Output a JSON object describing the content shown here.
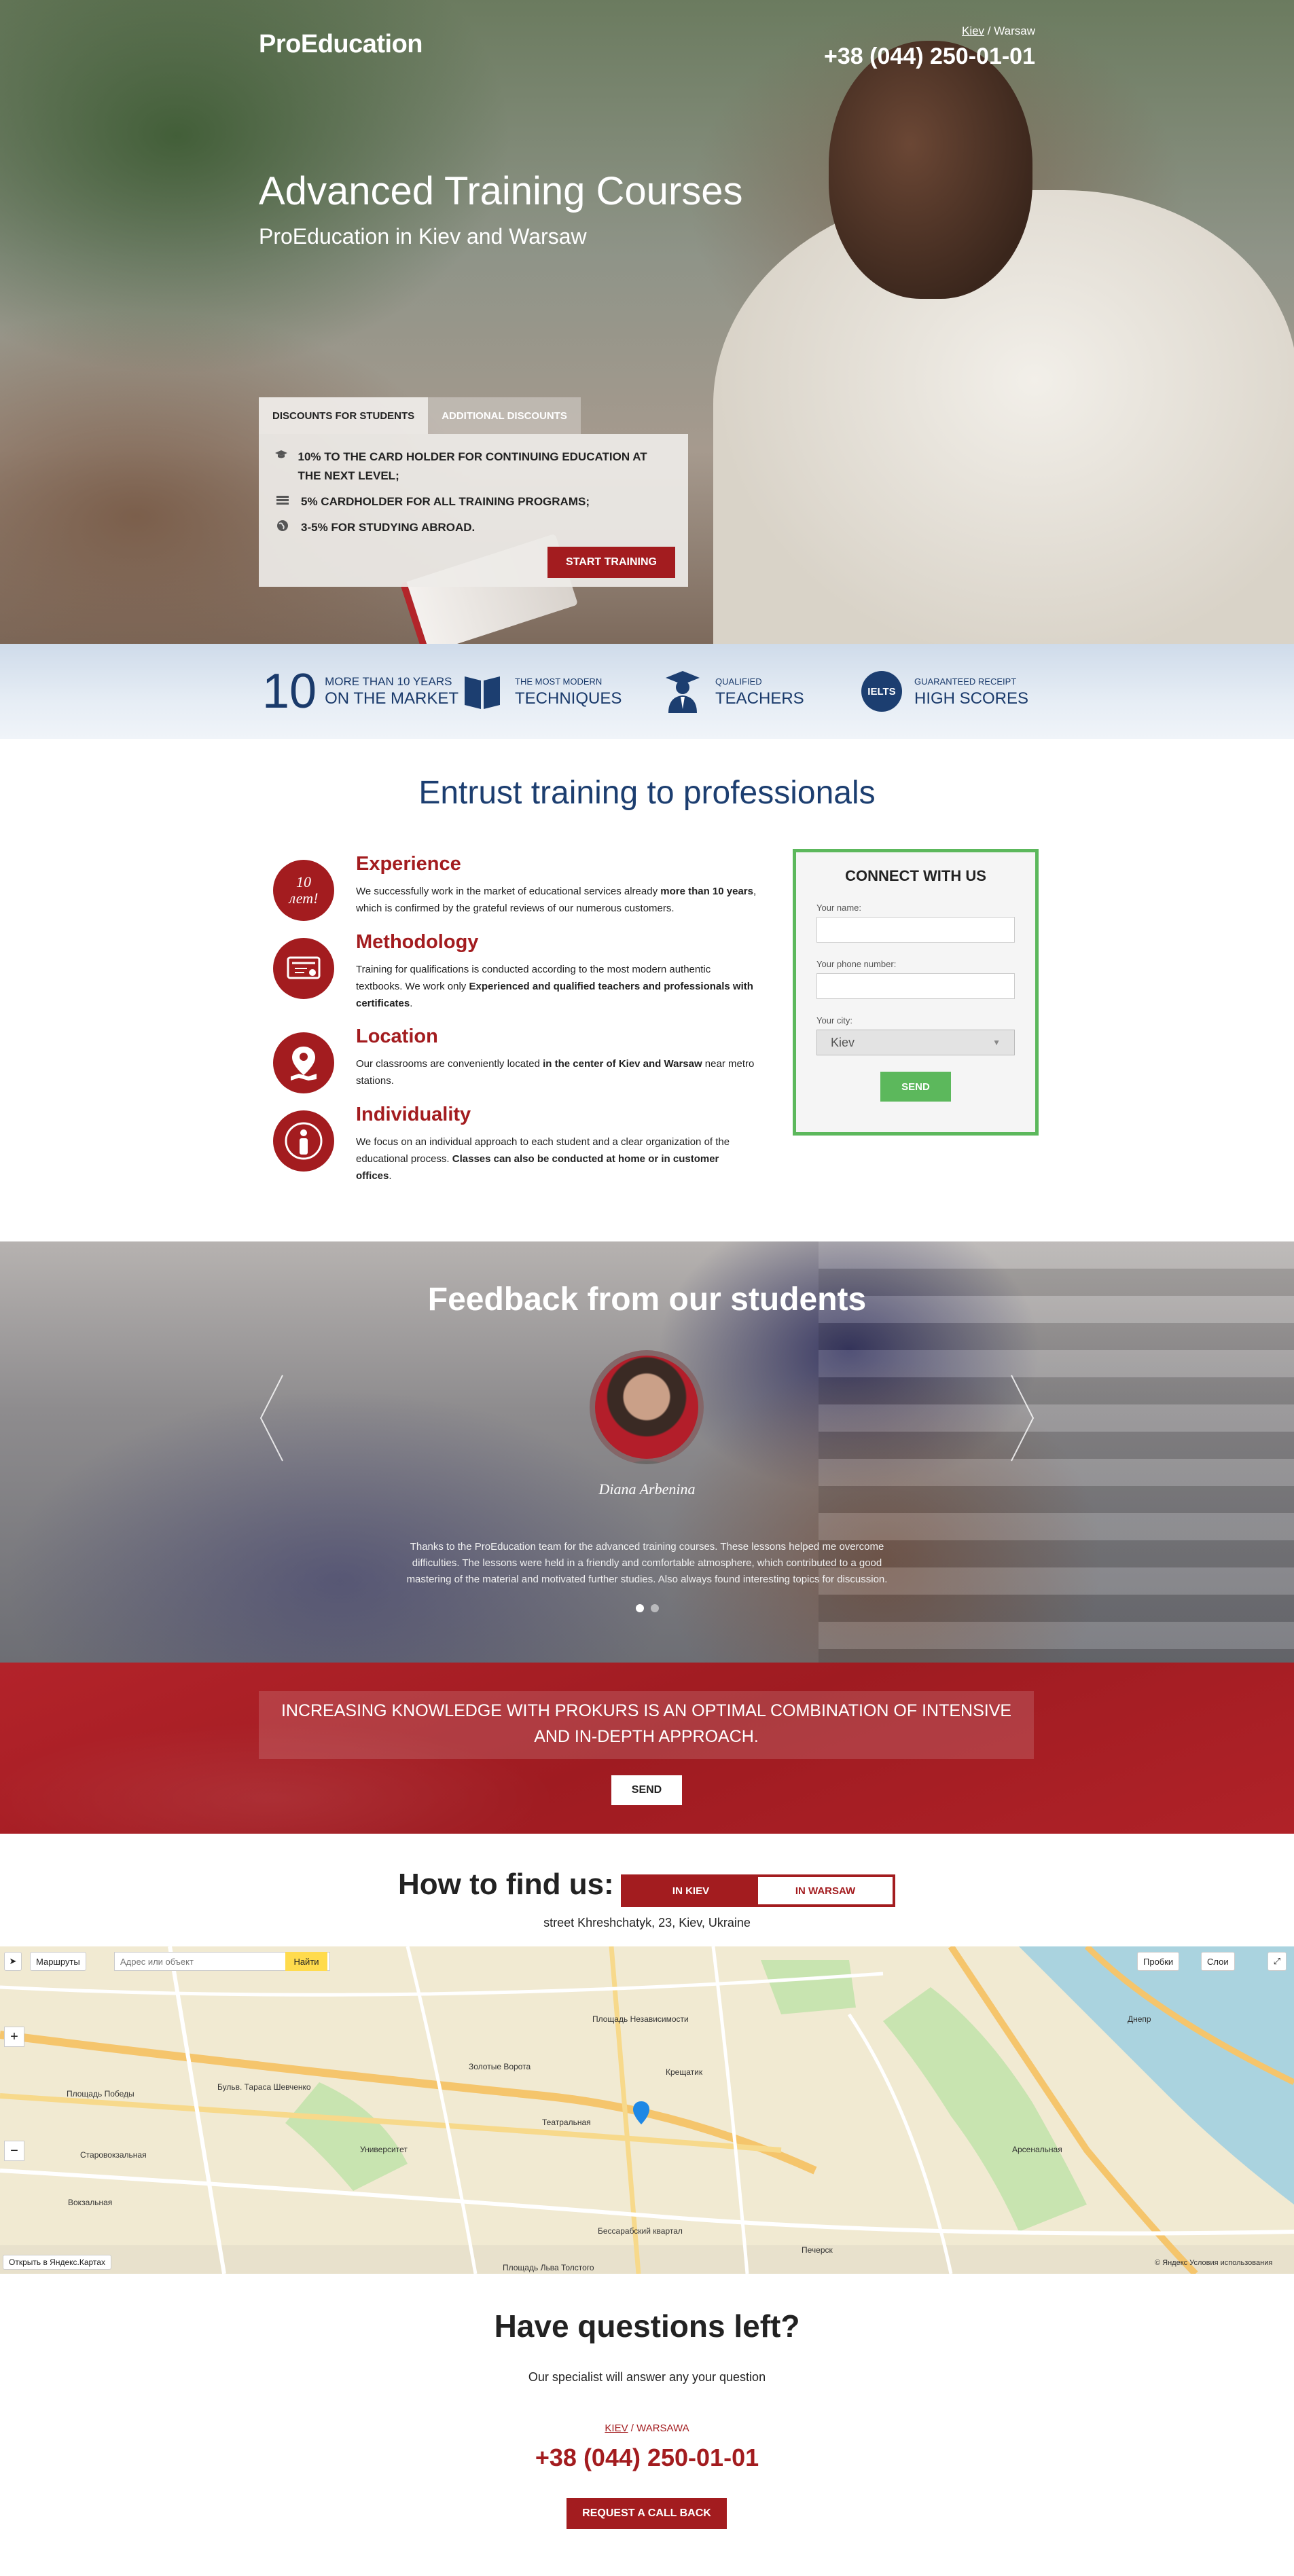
{
  "header": {
    "logo": "ProEducation",
    "city_active": "Kiev",
    "city_separator": " / ",
    "city_other": "Warsaw",
    "phone": "+38 (044) 250-01-01"
  },
  "hero": {
    "title": "Advanced Training Courses",
    "subtitle": "ProEducation in Kiev and Warsaw",
    "tabs": [
      {
        "label": "DISCOUNTS FOR STUDENTS",
        "active": true
      },
      {
        "label": "ADDITIONAL DISCOUNTS",
        "active": false
      }
    ],
    "discounts": [
      {
        "icon": "graduation-cap-icon",
        "text": "10% to the card holder for continuing education at the next level;"
      },
      {
        "icon": "card-icon",
        "text": "5% cardholder for all training programs;"
      },
      {
        "icon": "globe-icon",
        "text": "3-5% for studying abroad."
      }
    ],
    "start_button": "START TRAINING"
  },
  "features": [
    {
      "big": "10",
      "line1": "MORE THAN 10 YEARS",
      "line2": "ON THE MARKET"
    },
    {
      "icon": "book-icon",
      "line1": "THE MOST MODERN",
      "line2": "TECHNIQUES"
    },
    {
      "icon": "teacher-icon",
      "line1": "QUALIFIED",
      "line2": "TEACHERS"
    },
    {
      "icon": "ielts-icon",
      "badge": "IELTS",
      "line1": "GUARANTEED RECEIPT",
      "line2": "HIGH SCORES"
    }
  ],
  "professionals": {
    "title": "Entrust training to professionals",
    "badge_text": "10 лет!",
    "items": [
      {
        "heading": "Experience",
        "text_before": "We successfully work in the market of educational services already ",
        "bold": "more than 10 years",
        "text_after": ", which is confirmed by the grateful reviews of our numerous customers."
      },
      {
        "heading": "Methodology",
        "text_before": "Training for qualifications is conducted according to the most modern authentic textbooks. We work only ",
        "bold": "Experienced and qualified teachers and professionals with certificates",
        "text_after": "."
      },
      {
        "heading": "Location",
        "text_before": "Our classrooms are conveniently located ",
        "bold": "in the center of Kiev and Warsaw",
        "text_after": " near metro stations."
      },
      {
        "heading": "Individuality",
        "text_before": "We focus on an individual approach to each student and a clear organization of the educational process. ",
        "bold": "Classes can also be conducted at home or in customer offices",
        "text_after": "."
      }
    ]
  },
  "connect_form": {
    "title": "CONNECT WITH US",
    "name_label": "Your name:",
    "phone_label": "Your phone number:",
    "city_label": "Your city:",
    "city_value": "Kiev",
    "send": "SEND"
  },
  "feedback": {
    "title": "Feedback from our students",
    "name": "Diana Arbenina",
    "text": "Thanks to the ProEducation team for the advanced training courses. These lessons helped me overcome difficulties. The lessons were held in a friendly and comfortable atmosphere, which contributed to a good mastering of the material and motivated further studies. Also always found interesting topics for discussion.",
    "dots": [
      true,
      false
    ]
  },
  "slogan": {
    "text": "INCREASING KNOWLEDGE WITH PROKURS IS AN OPTIMAL COMBINATION OF INTENSIVE AND IN-DEPTH APPROACH.",
    "send": "SEND"
  },
  "find": {
    "title": "How to find us:",
    "tab_kiev": "IN KIEV",
    "tab_warsaw": "IN WARSAW",
    "address": "street Khreshchatyk, 23, Kiev, Ukraine"
  },
  "map": {
    "routes": "Маршруты",
    "search_placeholder": "Адрес или объект",
    "find_button": "Найти",
    "traffic": "Пробки",
    "layers": "Слои",
    "open_in": "Открыть в Яндекс.Картах",
    "copyright": "© Яндекс Условия использования",
    "labels": [
      "Площадь Независимости",
      "Золотые Ворота",
      "Театральная",
      "Крещатик",
      "Площадь Победы",
      "Университет",
      "Вокзальная",
      "Бессарабский квартал",
      "Арсенальная",
      "Днепр",
      "Старовокзальная",
      "Бульв. Тараса Шевченко",
      "Площадь Льва Толстого",
      "Печерск"
    ]
  },
  "questions": {
    "title": "Have questions left?",
    "subtitle": "Our specialist will answer any your question",
    "city_active": "KIEV",
    "city_separator": " / ",
    "city_other": "WARSAWA",
    "phone": "+38 (044) 250-01-01",
    "callback": "REQUEST A CALL BACK"
  },
  "colors": {
    "brand_red": "#a31c1f",
    "navy": "#1c3e70",
    "green": "#5cb85c"
  }
}
